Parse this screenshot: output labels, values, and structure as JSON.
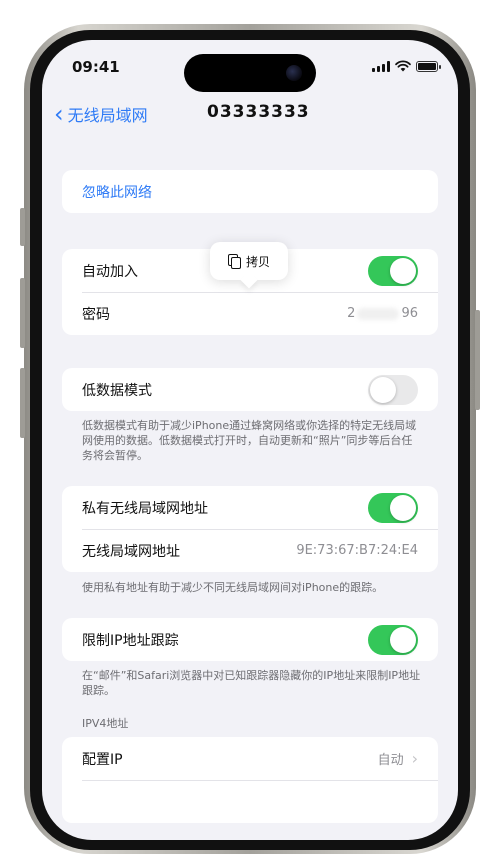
{
  "status_bar": {
    "time": "09:41"
  },
  "nav": {
    "back_label": "无线局域网",
    "title": "03333333"
  },
  "forget": {
    "label": "忽略此网络"
  },
  "join_group": {
    "auto_join_label": "自动加入",
    "auto_join_on": true,
    "password_label": "密码",
    "password_value_start": "2",
    "password_value_end": "96"
  },
  "copy_popup": {
    "label": "拷贝"
  },
  "low_data": {
    "label": "低数据模式",
    "enabled": false,
    "footnote": "低数据模式有助于减少iPhone通过蜂窝网络或你选择的特定无线局域网使用的数据。低数据模式打开时，自动更新和“照片”同步等后台任务将会暂停。"
  },
  "private_address": {
    "label": "私有无线局域网地址",
    "enabled": true,
    "mac_label": "无线局域网地址",
    "mac_value": "9E:73:67:B7:24:E4",
    "footnote": "使用私有地址有助于减少不同无线局域网间对iPhone的跟踪。"
  },
  "limit_tracking": {
    "label": "限制IP地址跟踪",
    "enabled": true,
    "footnote": "在“邮件”和Safari浏览器中对已知跟踪器隐藏你的IP地址来限制IP地址跟踪。"
  },
  "ipv4": {
    "header": "IPV4地址",
    "configure_label": "配置IP",
    "configure_value": "自动"
  }
}
